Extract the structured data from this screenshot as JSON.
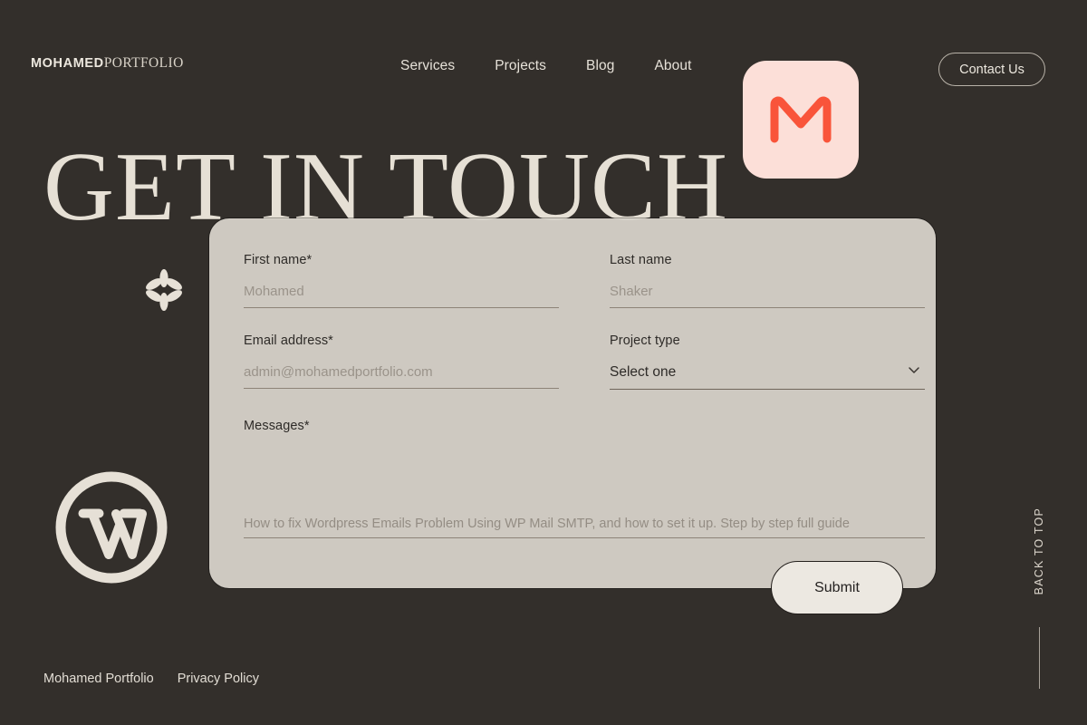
{
  "theme": {
    "background": "#332f2b",
    "card_background": "#d8d3cb",
    "cream": "#e8e3da",
    "accent_pink": "#fcdfd8",
    "accent_red": "#f9543a",
    "button_cream": "#ece8e1"
  },
  "header": {
    "logo": {
      "bold_part": "MOHAMED",
      "light_part": "PORTFOLIO"
    },
    "nav": [
      {
        "label": "Services"
      },
      {
        "label": "Projects"
      },
      {
        "label": "Blog"
      },
      {
        "label": "About"
      }
    ],
    "contact_button": "Contact Us",
    "mail_badge_icon": "gmail-m-icon"
  },
  "hero": {
    "headline": "GET IN TOUCH",
    "asterisk_icon": "asterisk-flower-icon",
    "wordpress_icon": "wordpress-logo-icon"
  },
  "form": {
    "first_name": {
      "label": "First name*",
      "placeholder": "Mohamed",
      "value": ""
    },
    "last_name": {
      "label": "Last name",
      "placeholder": "Shaker",
      "value": ""
    },
    "email": {
      "label": "Email address*",
      "placeholder": "admin@mohamedportfolio.com",
      "value": ""
    },
    "project_type": {
      "label": "Project type",
      "selected": "Select one",
      "chevron_icon": "chevron-down-icon"
    },
    "messages": {
      "label": "Messages*",
      "placeholder": "How to fix Wordpress Emails Problem Using WP Mail SMTP, and how to set it up. Step by step full guide",
      "value": ""
    },
    "submit_button": "Submit"
  },
  "back_to_top": {
    "label": "BACK TO TOP"
  },
  "footer": {
    "links": [
      {
        "label": "Mohamed Portfolio"
      },
      {
        "label": "Privacy Policy"
      }
    ]
  }
}
